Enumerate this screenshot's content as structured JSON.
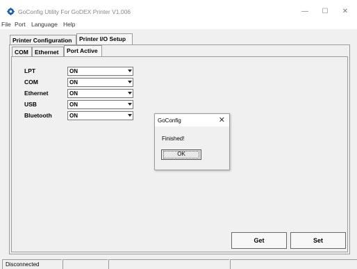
{
  "window": {
    "title": "GoConfig Utility For GoDEX Printer V1.006",
    "minimize_glyph": "—",
    "maximize_glyph": "☐",
    "close_glyph": "✕"
  },
  "menu": {
    "items": [
      {
        "label": "File"
      },
      {
        "label": "Port"
      },
      {
        "label": "Language"
      },
      {
        "label": "Help"
      }
    ]
  },
  "main_tabs": [
    {
      "label": "Printer Configuration"
    },
    {
      "label": "Printer I/O Setup"
    }
  ],
  "sub_tabs": [
    {
      "label": "COM"
    },
    {
      "label": "Ethernet"
    },
    {
      "label": "Port Active"
    }
  ],
  "ports": [
    {
      "label": "LPT",
      "value": "ON"
    },
    {
      "label": "COM",
      "value": "ON"
    },
    {
      "label": "Ethernet",
      "value": "ON"
    },
    {
      "label": "USB",
      "value": "ON"
    },
    {
      "label": "Bluetooth",
      "value": "ON"
    }
  ],
  "buttons": {
    "get": "Get",
    "set": "Set"
  },
  "dialog": {
    "title": "GoConfig",
    "close_glyph": "✕",
    "message": "Finished!",
    "ok": "OK"
  },
  "status": {
    "connection": "Disconnected"
  },
  "colors": {
    "app_icon": "#1f5fb0"
  }
}
